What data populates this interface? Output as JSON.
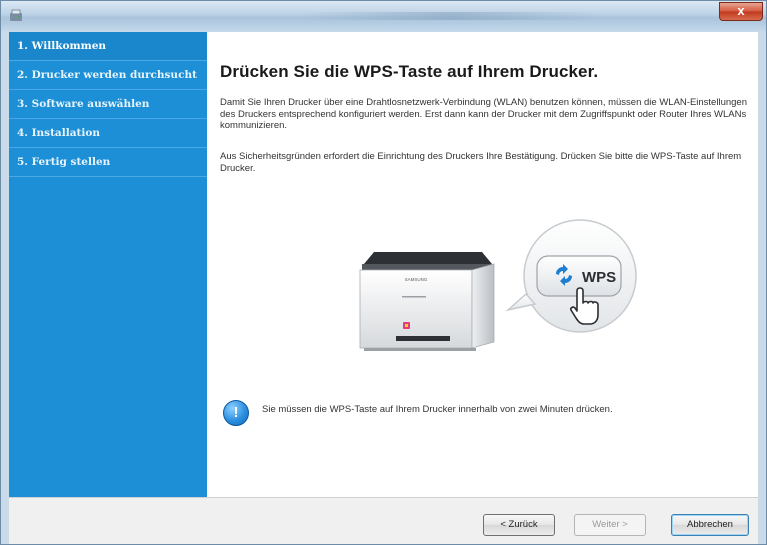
{
  "window": {
    "title_icon": "installer-app-icon",
    "close_label": "x"
  },
  "sidebar": {
    "steps": [
      {
        "label": "1. Willkommen",
        "active": true
      },
      {
        "label": "2. Drucker werden durchsucht",
        "active": false
      },
      {
        "label": "3. Software auswählen",
        "active": false
      },
      {
        "label": "4. Installation",
        "active": false
      },
      {
        "label": "5. Fertig stellen",
        "active": false
      }
    ]
  },
  "main": {
    "heading": "Drücken Sie die WPS-Taste auf Ihrem Drucker.",
    "paragraph1": "Damit Sie Ihren Drucker über eine Drahtlosnetzwerk-Verbindung (WLAN) benutzen können, müssen die WLAN-Einstellungen des Druckers entsprechend konfiguriert werden. Erst dann kann der Drucker mit dem Zugriffspunkt oder Router Ihres WLANs kommunizieren.",
    "paragraph2": "Aus Sicherheitsgründen erfordert die Einrichtung des Druckers Ihre Bestätigung. Drücken Sie bitte die WPS-Taste auf Ihrem Drucker.",
    "illustration": {
      "printer_brand": "SAMSUNG",
      "wps_label": "WPS"
    },
    "note": {
      "icon": "info-icon",
      "text": "Sie müssen die WPS-Taste auf Ihrem Drucker innerhalb von zwei Minuten drücken."
    }
  },
  "footer": {
    "back_label": "< Zurück",
    "next_label": "Weiter >",
    "cancel_label": "Abbrechen"
  },
  "colors": {
    "sidebar_bg": "#1c8fd6",
    "accent": "#1c8fd6"
  }
}
